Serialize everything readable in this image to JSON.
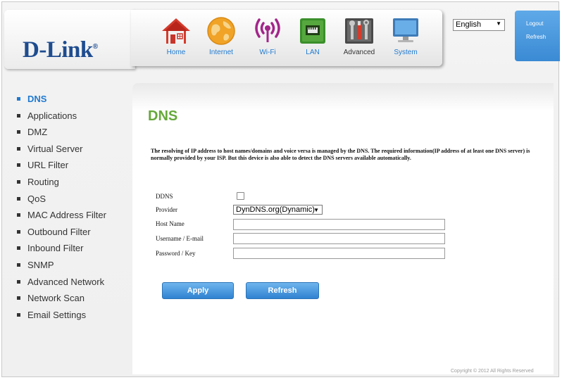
{
  "brand": {
    "logo": "D-Link",
    "reg": "®"
  },
  "nav": [
    {
      "label": "Home",
      "icon": "home-icon"
    },
    {
      "label": "Internet",
      "icon": "globe-icon"
    },
    {
      "label": "Wi-Fi",
      "icon": "wifi-icon"
    },
    {
      "label": "LAN",
      "icon": "lan-icon"
    },
    {
      "label": "Advanced",
      "icon": "tools-icon",
      "active": true
    },
    {
      "label": "System",
      "icon": "monitor-icon"
    }
  ],
  "language": {
    "selected": "English"
  },
  "toplinks": {
    "logout": "Logout",
    "refresh": "Refresh"
  },
  "sidebar": [
    {
      "label": "DNS",
      "active": true
    },
    {
      "label": "Applications"
    },
    {
      "label": "DMZ"
    },
    {
      "label": "Virtual Server"
    },
    {
      "label": "URL Filter"
    },
    {
      "label": "Routing"
    },
    {
      "label": "QoS"
    },
    {
      "label": "MAC Address Filter"
    },
    {
      "label": "Outbound Filter"
    },
    {
      "label": "Inbound Filter"
    },
    {
      "label": "SNMP"
    },
    {
      "label": "Advanced Network"
    },
    {
      "label": "Network Scan"
    },
    {
      "label": "Email Settings"
    }
  ],
  "main": {
    "title": "DNS",
    "description": "The resolving of IP address to host names/domains and voice versa is managed by the DNS. The required information(IP address of at least one DNS server) is normally provided by your ISP. But this device is also able to detect the DNS servers available automatically.",
    "form": {
      "ddns_label": "DDNS",
      "ddns_checked": false,
      "provider_label": "Provider",
      "provider_value": "DynDNS.org(Dynamic)",
      "hostname_label": "Host Name",
      "hostname_value": "",
      "username_label": "Username / E-mail",
      "username_value": "",
      "password_label": "Password / Key",
      "password_value": ""
    },
    "apply_label": "Apply",
    "refresh_label": "Refresh"
  },
  "footer": {
    "copyright": "Copyright © 2012  All Rights Reserved"
  },
  "colors": {
    "accent_blue": "#1f7ad1",
    "title_green": "#66a83a",
    "logo_blue": "#1e4c8f",
    "button_blue": "#3d8fd9"
  }
}
